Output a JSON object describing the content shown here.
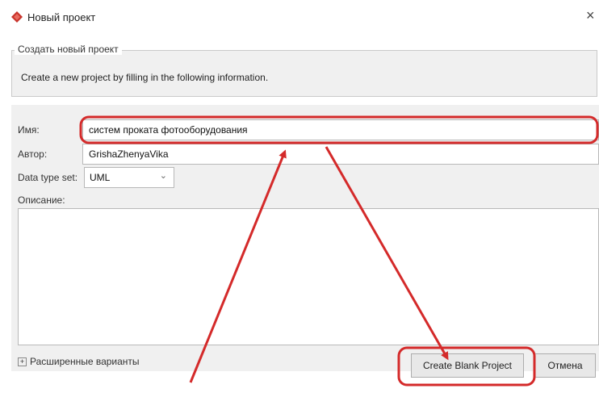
{
  "window": {
    "title": "Новый проект",
    "close_glyph": "×"
  },
  "group": {
    "legend": "Создать новый проект",
    "description": "Create a new project by filling in the following information."
  },
  "form": {
    "name_label": "Имя:",
    "name_value": "систем проката фотооборудования",
    "author_label": "Автор:",
    "author_value": "GrishaZhenyaVika",
    "datatype_label": "Data type set:",
    "datatype_value": "UML",
    "description_label": "Описание:",
    "description_value": ""
  },
  "advanced": {
    "label": "Расширенные варианты",
    "toggle_glyph": "+"
  },
  "buttons": {
    "create": "Create Blank Project",
    "cancel": "Отмена"
  },
  "colors": {
    "annotation_red": "#d42a2a",
    "accent_icon": "#c8332b"
  }
}
